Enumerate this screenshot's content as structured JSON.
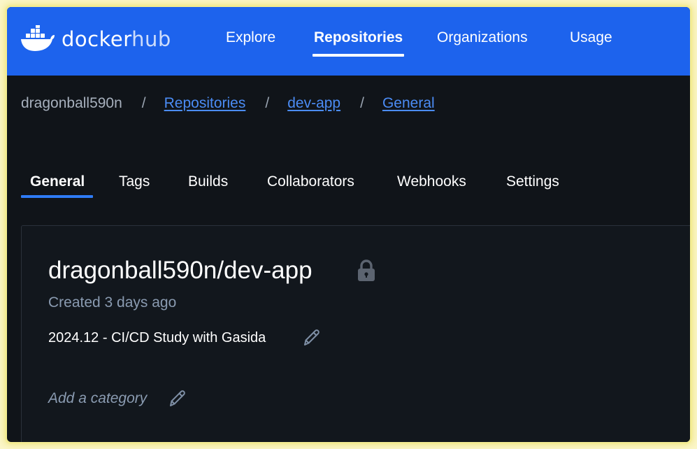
{
  "brand": {
    "name_part1": "docker",
    "name_part2": "hub"
  },
  "nav": {
    "items": [
      {
        "label": "Explore"
      },
      {
        "label": "Repositories",
        "active": true
      },
      {
        "label": "Organizations"
      },
      {
        "label": "Usage"
      }
    ]
  },
  "breadcrumb": {
    "user": "dragonball590n",
    "separator": "/",
    "items": [
      {
        "label": "Repositories"
      },
      {
        "label": "dev-app"
      },
      {
        "label": "General"
      }
    ]
  },
  "tabs": {
    "items": [
      {
        "label": "General",
        "active": true
      },
      {
        "label": "Tags"
      },
      {
        "label": "Builds"
      },
      {
        "label": "Collaborators"
      },
      {
        "label": "Webhooks"
      },
      {
        "label": "Settings"
      }
    ]
  },
  "repo": {
    "title": "dragonball590n/dev-app",
    "visibility_icon": "lock-icon",
    "created": "Created 3 days ago",
    "description": "2024.12 - CI/CD Study with Gasida",
    "add_category": "Add a category"
  },
  "colors": {
    "brand_blue": "#1d63ed",
    "background": "#101419",
    "link": "#4b8cf5",
    "tab_accent": "#2f7cf6",
    "muted_text": "#8a9bb1"
  }
}
